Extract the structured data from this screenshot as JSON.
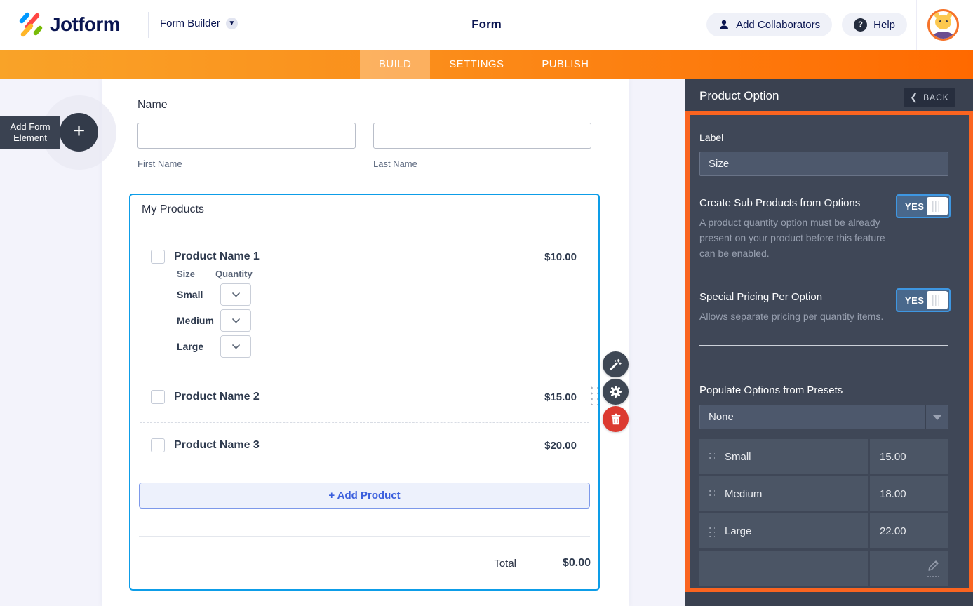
{
  "header": {
    "brand": "Jotform",
    "breadcrumb": "Form Builder",
    "title": "Form",
    "add_collaborators_label": "Add Collaborators",
    "help_label": "Help"
  },
  "nav": {
    "tabs": [
      {
        "label": "BUILD",
        "active": true
      },
      {
        "label": "SETTINGS",
        "active": false
      },
      {
        "label": "PUBLISH",
        "active": false
      }
    ]
  },
  "sidebar": {
    "add_element_label": "Add Form Element",
    "plus": "+"
  },
  "canvas": {
    "name_field": {
      "label": "Name",
      "first": "First Name",
      "last": "Last Name"
    },
    "products": {
      "title": "My Products",
      "option_headers": {
        "col1": "Size",
        "col2": "Quantity"
      },
      "option_rows": [
        "Small",
        "Medium",
        "Large"
      ],
      "items": [
        {
          "name": "Product Name 1",
          "price": "$10.00"
        },
        {
          "name": "Product Name 2",
          "price": "$15.00"
        },
        {
          "name": "Product Name 3",
          "price": "$20.00"
        }
      ],
      "add_product_label": "+ Add Product",
      "total_label": "Total",
      "total_value": "$0.00"
    }
  },
  "panel": {
    "title": "Product Option",
    "back_label": "BACK",
    "back_chevron": "❮",
    "label_field": {
      "label": "Label",
      "value": "Size"
    },
    "sub_products": {
      "label": "Create Sub Products from Options",
      "state": "YES",
      "help": "A product quantity option must be already present on your product before this feature can be enabled."
    },
    "special_pricing": {
      "label": "Special Pricing Per Option",
      "state": "YES",
      "help": "Allows separate pricing per quantity items."
    },
    "presets": {
      "label": "Populate Options from Presets",
      "value": "None"
    },
    "options": [
      {
        "name": "Small",
        "price": "15.00"
      },
      {
        "name": "Medium",
        "price": "18.00"
      },
      {
        "name": "Large",
        "price": "22.00"
      }
    ]
  },
  "colors": {
    "accent_orange": "#fa6420",
    "nav_gradient_start": "#f9a328",
    "nav_gradient_end": "#ff6900",
    "selection_blue": "#0d9de8",
    "brand_navy": "#0a1551",
    "panel_bg": "#3f4757",
    "toggle_blue": "#3e97e2",
    "danger_red": "#dc3a30"
  }
}
